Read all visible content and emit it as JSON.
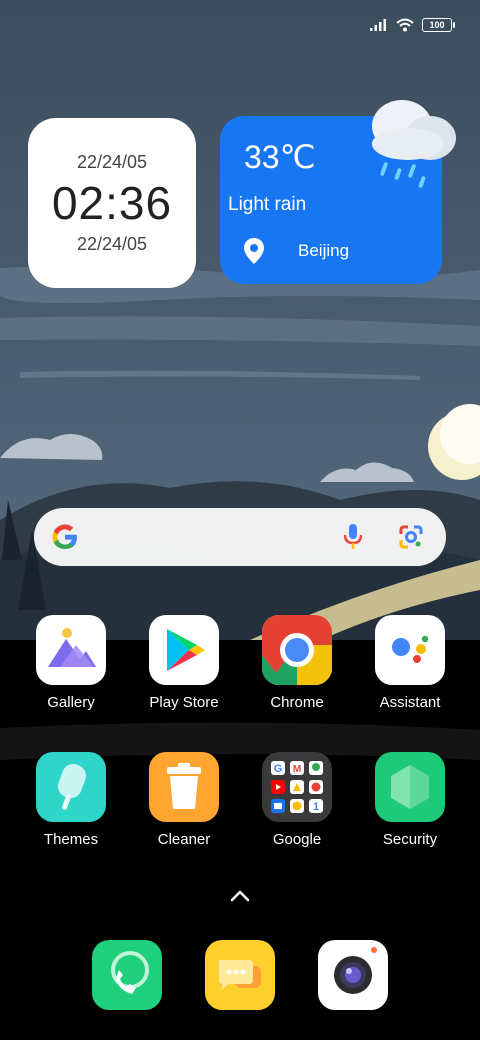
{
  "status_bar": {
    "battery_level": "100",
    "icons": [
      "signal-icon",
      "wifi-icon",
      "battery-icon"
    ]
  },
  "clock_widget": {
    "date_top": "22/24/05",
    "time": "02:36",
    "date_bottom": "22/24/05"
  },
  "weather_widget": {
    "temperature": "33℃",
    "condition": "Light rain",
    "location": "Beijing",
    "accent": "#1976f2"
  },
  "search_bar": {
    "icons": [
      "google-g-icon",
      "microphone-icon",
      "google-lens-icon"
    ]
  },
  "apps_row1": [
    {
      "label": "Gallery"
    },
    {
      "label": "Play Store"
    },
    {
      "label": "Chrome"
    },
    {
      "label": "Assistant"
    }
  ],
  "apps_row2": [
    {
      "label": "Themes"
    },
    {
      "label": "Cleaner"
    },
    {
      "label": "Google"
    },
    {
      "label": "Security"
    }
  ],
  "dock": {
    "apps": [
      "phone-icon",
      "messages-icon",
      "camera-icon"
    ]
  }
}
